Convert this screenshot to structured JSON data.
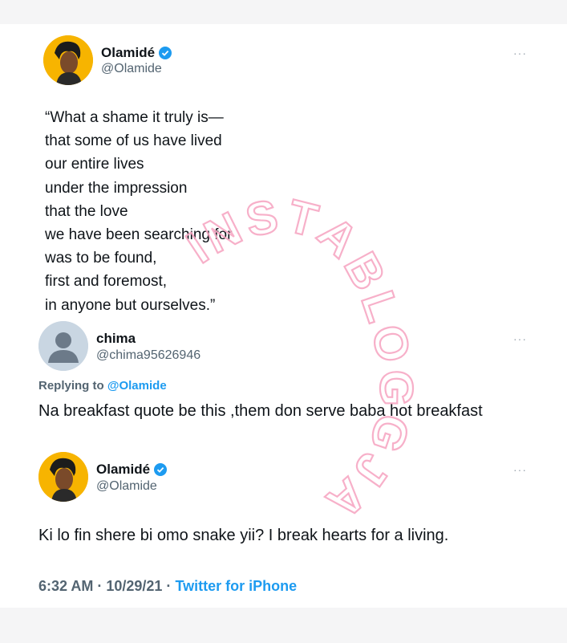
{
  "tweets": [
    {
      "name": "Olamidé",
      "handle": "@Olamide",
      "lines": [
        "“What a shame it truly is—",
        "that some of us have lived",
        "our entire lives",
        "under the impression",
        "that the love",
        "we have been searching for",
        "was to be found,",
        "first and foremost,",
        "in anyone but ourselves.”"
      ]
    },
    {
      "name": "chima",
      "handle": "@chima95626946",
      "replying_prefix": "Replying to",
      "replying_mention": "@Olamide",
      "text": "Na breakfast quote be this ,them don serve baba hot breakfast"
    },
    {
      "name": "Olamidé",
      "handle": "@Olamide",
      "text": "Ki lo fin shere bi omo snake yii? I break hearts for a living.",
      "time": "6:32 AM · 10/29/21 ·",
      "source": "Twitter for iPhone"
    }
  ],
  "more_label": "···",
  "watermark": "INSTABLOGGJA",
  "colors": {
    "accent": "#1d9bf0",
    "watermark": "#f7a8c4",
    "avatar_bg": "#f7b400"
  }
}
